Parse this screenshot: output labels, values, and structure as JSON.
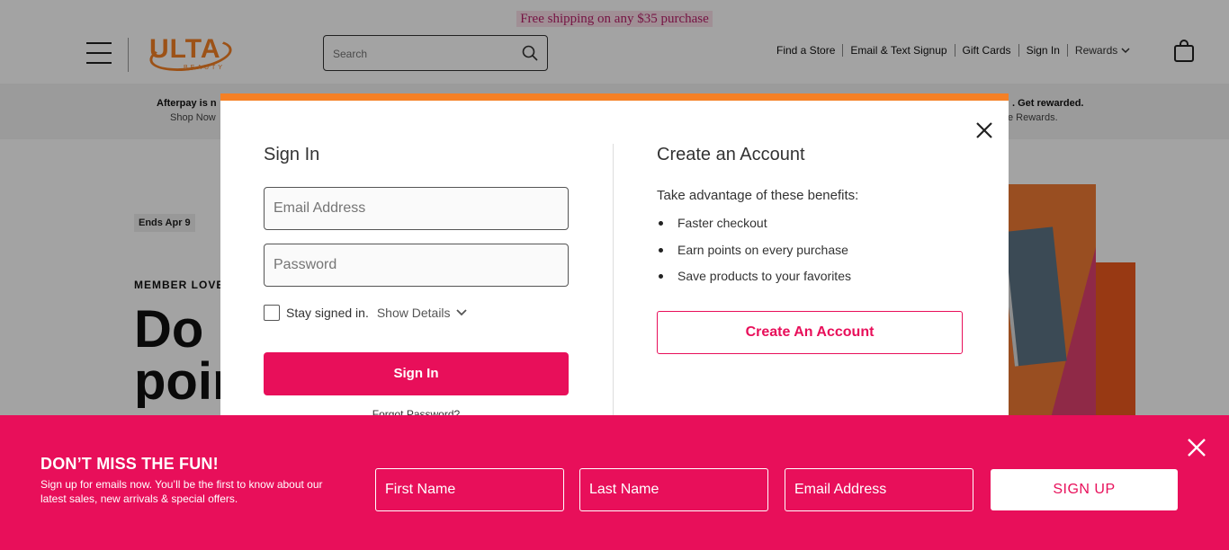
{
  "promo": {
    "text": "Free shipping on any $35 purchase"
  },
  "header": {
    "logo_text": "ULTA",
    "logo_sub": "BEAUTY",
    "search_placeholder": "Search",
    "nav": [
      "Find a Store",
      "Email & Text Signup",
      "Gift Cards",
      "Sign In",
      "Rewards"
    ]
  },
  "afterpay": {
    "left_line1": "Afterpay is n",
    "left_line2": "Shop Now",
    "right_line1": ". Get rewarded.",
    "right_line2": "e Rewards."
  },
  "hero": {
    "badge": "Ends Apr 9",
    "kicker": "MEMBER LOVE",
    "title_line1": "Do i",
    "title_line2": "poin"
  },
  "modal": {
    "signin_title": "Sign In",
    "email_placeholder": "Email Address",
    "password_placeholder": "Password",
    "stay_signed_in": "Stay signed in.",
    "show_details": "Show Details",
    "signin_button": "Sign In",
    "forgot_password": "Forgot Password?",
    "create_title": "Create an Account",
    "benefits_intro": "Take advantage of these benefits:",
    "benefits": [
      "Faster checkout",
      "Earn points on every purchase",
      "Save products to your favorites"
    ],
    "create_button": "Create An Account"
  },
  "email_banner": {
    "title": "DON’T MISS THE FUN!",
    "subtitle": "Sign up for emails now. You’ll be the first to know about our latest sales, new arrivals & special offers.",
    "first_name_placeholder": "First Name",
    "last_name_placeholder": "Last Name",
    "email_placeholder": "Email Address",
    "signup_button": "SIGN UP"
  },
  "colors": {
    "brand_orange": "#f58025",
    "brand_pink": "#e80f5a"
  }
}
